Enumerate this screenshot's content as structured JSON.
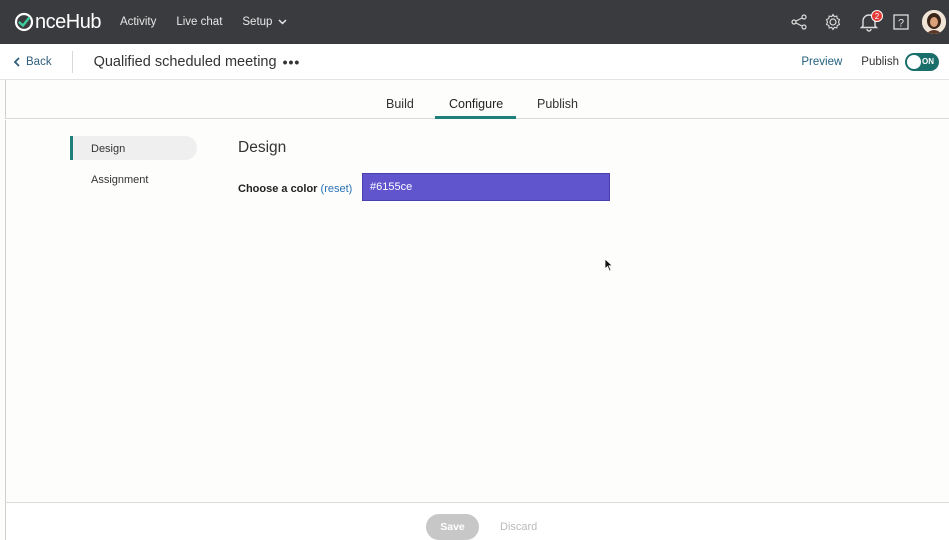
{
  "topnav": {
    "logo_text": "nceHub",
    "links": [
      {
        "label": "Activity"
      },
      {
        "label": "Live chat"
      },
      {
        "label": "Setup"
      }
    ],
    "notification_count": "2",
    "icons": [
      "share-icon",
      "settings-gear-icon",
      "notification-bell-icon",
      "help-icon",
      "user-avatar"
    ]
  },
  "subheader": {
    "back_label": "Back",
    "title": "Qualified scheduled meeting",
    "more_label": "•••",
    "preview_label": "Preview",
    "publish_label": "Publish",
    "toggle_label": "ON"
  },
  "tabs": [
    {
      "label": "Build"
    },
    {
      "label": "Configure",
      "active": true
    },
    {
      "label": "Publish"
    }
  ],
  "sidebar": {
    "items": [
      {
        "label": "Design",
        "active": true
      },
      {
        "label": "Assignment"
      }
    ]
  },
  "design": {
    "title": "Design",
    "color_label": "Choose a color",
    "reset_label": "(reset)",
    "color_value": "#6155ce"
  },
  "footer": {
    "save_label": "Save",
    "discard_label": "Discard"
  },
  "colors": {
    "nav_bg": "#3a3b3e",
    "accent": "#1f7f7a",
    "selected_color": "#6155ce"
  }
}
